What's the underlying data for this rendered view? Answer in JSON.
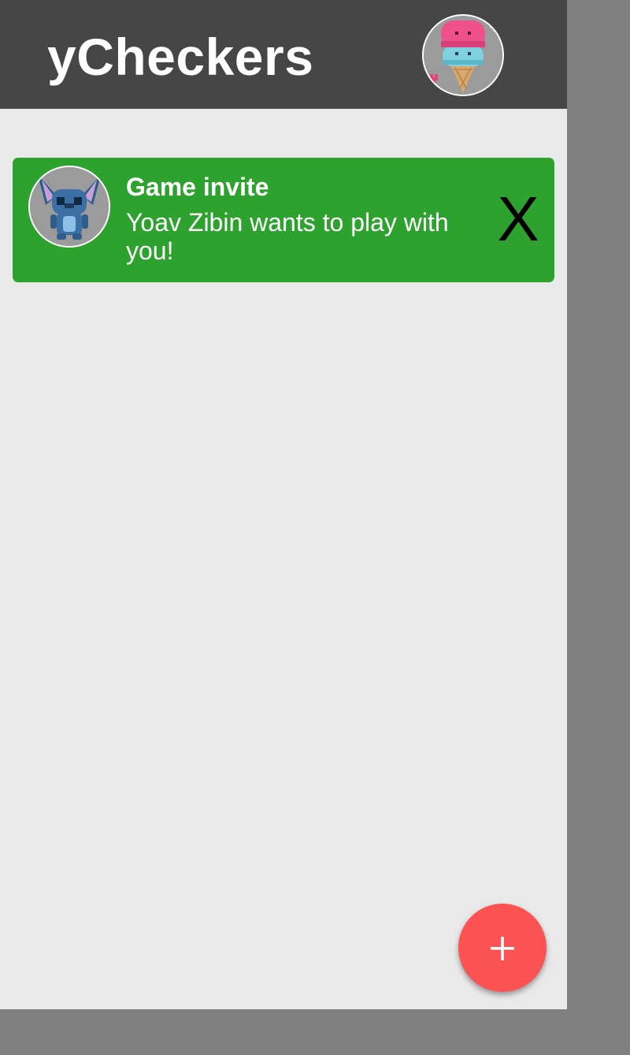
{
  "app": {
    "title": "yCheckers",
    "profile_avatar_icon": "ice-cream-avatar-icon"
  },
  "notification": {
    "title": "Game invite",
    "message": "Yoav Zibin wants to play with you!",
    "dismiss_label": "X",
    "avatar_icon": "stitch-avatar-icon",
    "background_color": "#2ea22e"
  },
  "fab": {
    "icon": "plus-icon",
    "color": "#fb5353"
  },
  "colors": {
    "header": "#464646",
    "content": "#e9e9e9",
    "outer": "#808080"
  }
}
